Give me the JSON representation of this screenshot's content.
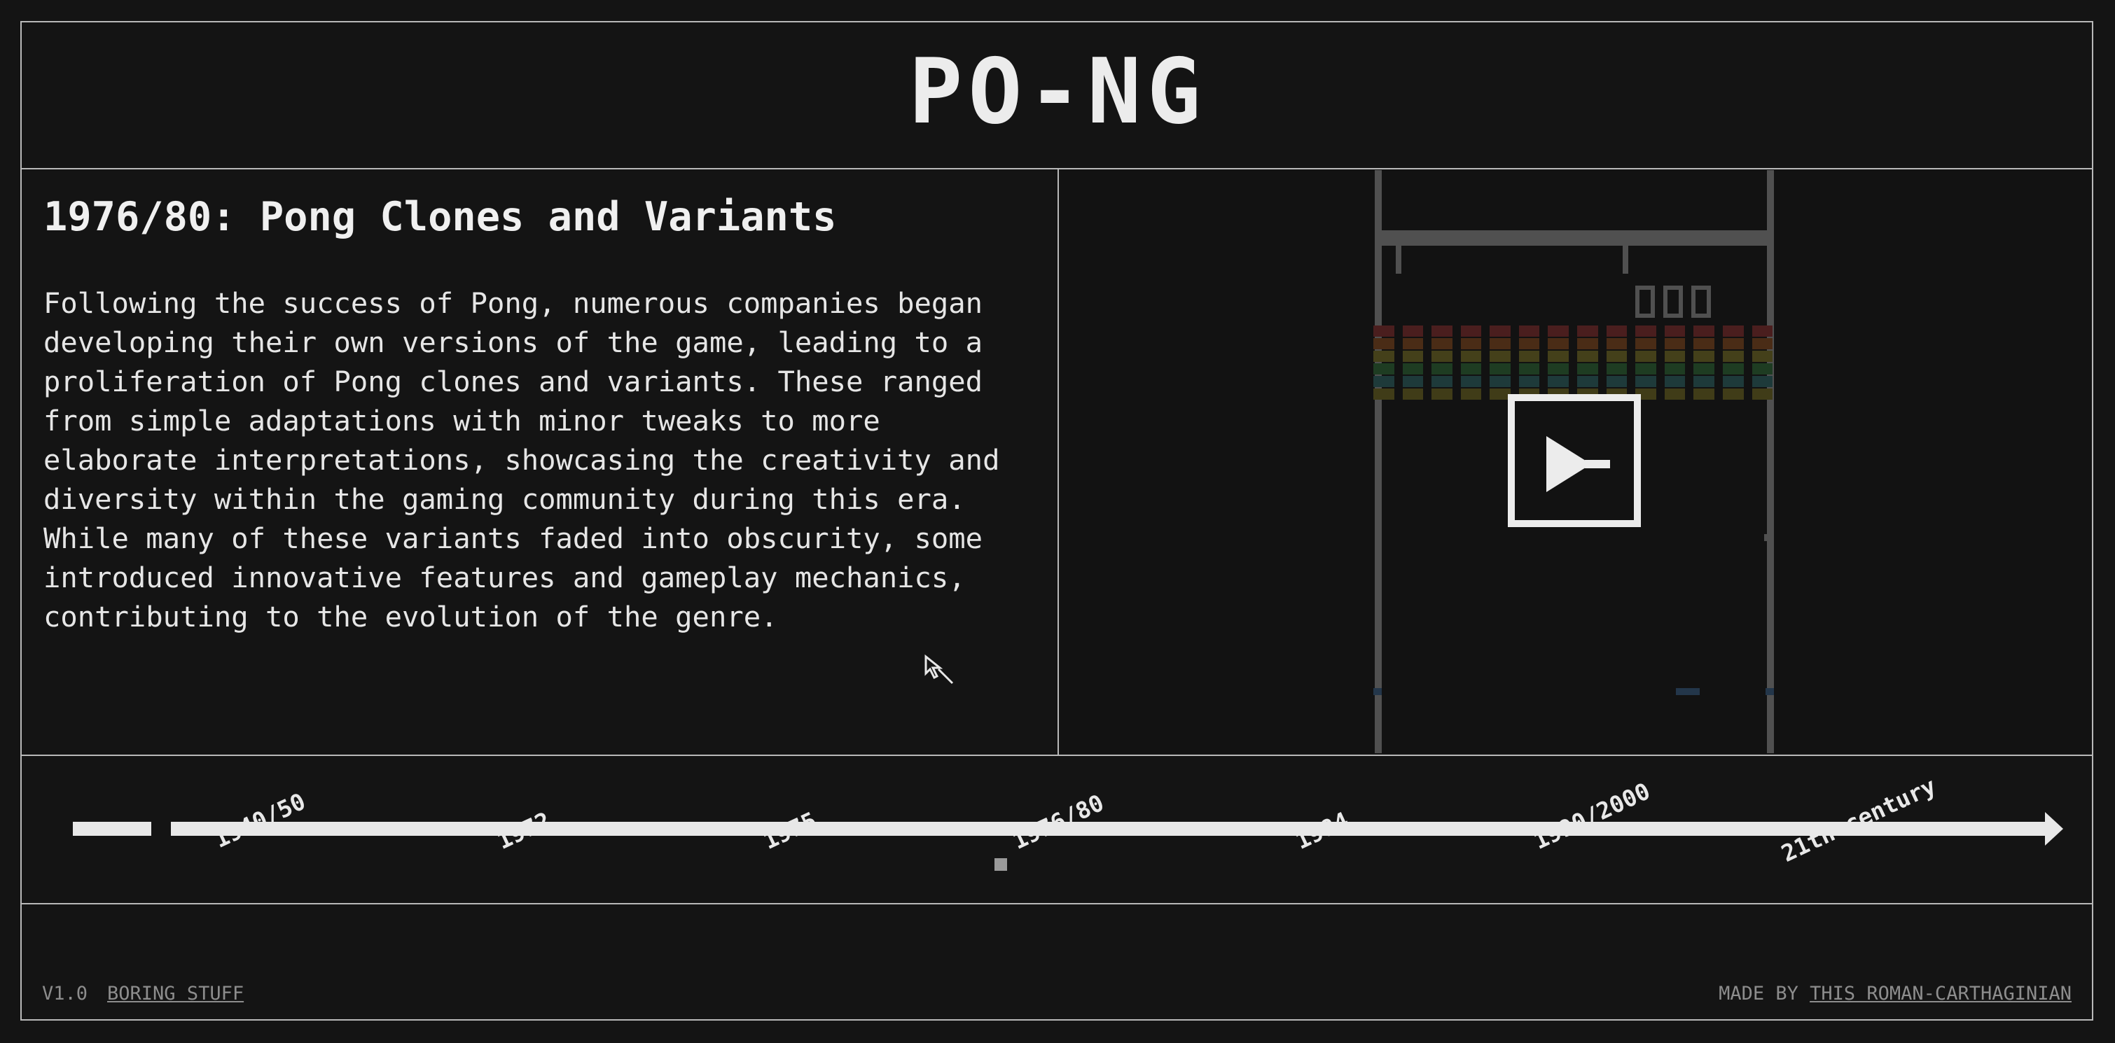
{
  "header": {
    "logo": "PO-NG"
  },
  "article": {
    "title": "1976/80: Pong Clones and Variants",
    "body": "Following the success of Pong, numerous companies began developing their own versions of the game, leading to a proliferation of Pong clones and variants. These ranged from simple adaptations with minor tweaks to more elaborate interpretations, showcasing the creativity and diversity within the gaming community during this era. While many of these variants faded into obscurity, some introduced innovative features and gameplay mechanics, contributing to the evolution of the genre."
  },
  "game_preview": {
    "score_digits": 3,
    "brick_colors": [
      "#4a1e1e",
      "#4a2c16",
      "#44401a",
      "#1e3c22",
      "#1e3a3a",
      "#403c18"
    ],
    "wall_color": "#505050",
    "play_icon": "play-icon"
  },
  "timeline": {
    "items": [
      {
        "label": "1940/50"
      },
      {
        "label": "1972"
      },
      {
        "label": "1975"
      },
      {
        "label": "1976/80",
        "active": true
      },
      {
        "label": "1984"
      },
      {
        "label": "1990/2000"
      },
      {
        "label": "21th century"
      }
    ]
  },
  "footer": {
    "version": "V1.0",
    "boring_link": "BORING STUFF",
    "made_by_prefix": "MADE BY",
    "author_link": "THIS ROMAN-CARTHAGINIAN"
  }
}
